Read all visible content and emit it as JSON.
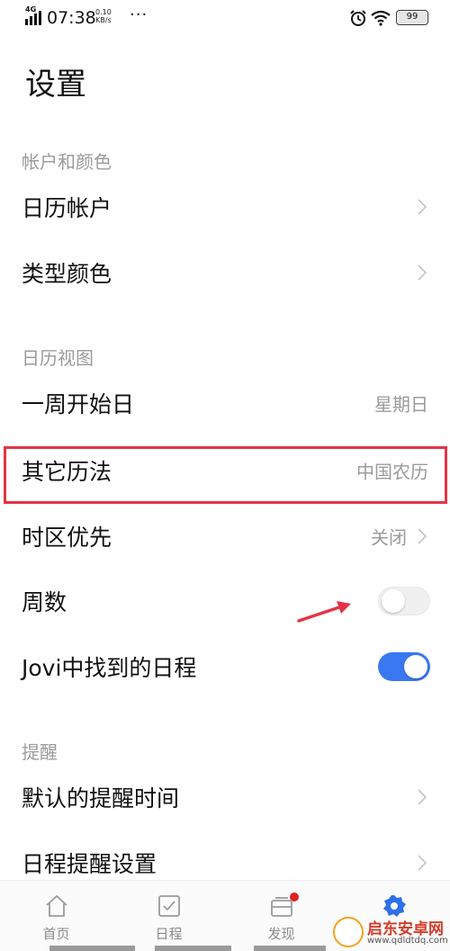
{
  "status_bar": {
    "network": "4G",
    "time": "07:38",
    "speed_value": "0.10",
    "speed_unit": "KB/s",
    "more_dots": "···",
    "battery": "99",
    "icons": [
      "signal-icon",
      "alarm-icon",
      "wifi-icon",
      "battery-icon"
    ]
  },
  "page": {
    "title": "设置"
  },
  "sections": {
    "account": {
      "title": "帐户和颜色",
      "items": [
        {
          "label": "日历帐户",
          "has_chevron": true
        },
        {
          "label": "类型颜色",
          "has_chevron": true
        }
      ]
    },
    "view": {
      "title": "日历视图",
      "items": [
        {
          "label": "一周开始日",
          "value": "星期日"
        },
        {
          "label": "其它历法",
          "value": "中国农历"
        },
        {
          "label": "时区优先",
          "value": "关闭",
          "has_chevron": true
        },
        {
          "label": "周数",
          "toggle": false
        },
        {
          "label": "Jovi中找到的日程",
          "toggle": true
        }
      ]
    },
    "reminder": {
      "title": "提醒",
      "items": [
        {
          "label": "默认的提醒时间",
          "has_chevron": true
        },
        {
          "label": "日程提醒设置",
          "has_chevron": true
        }
      ]
    }
  },
  "bottom_nav": {
    "items": [
      {
        "label": "首页",
        "icon": "home-icon"
      },
      {
        "label": "日程",
        "icon": "checkbox-icon"
      },
      {
        "label": "发现",
        "icon": "discover-icon",
        "badge": true
      },
      {
        "label": "",
        "icon": "settings-gear-icon",
        "active": true
      }
    ]
  },
  "watermark": {
    "text": "启东安卓网",
    "url": "www.qdldtdq.com"
  },
  "colors": {
    "accent": "#3a78f2",
    "highlight": "#e53345",
    "arrow": "#e53345",
    "secondary_text": "#9b9b9b"
  }
}
